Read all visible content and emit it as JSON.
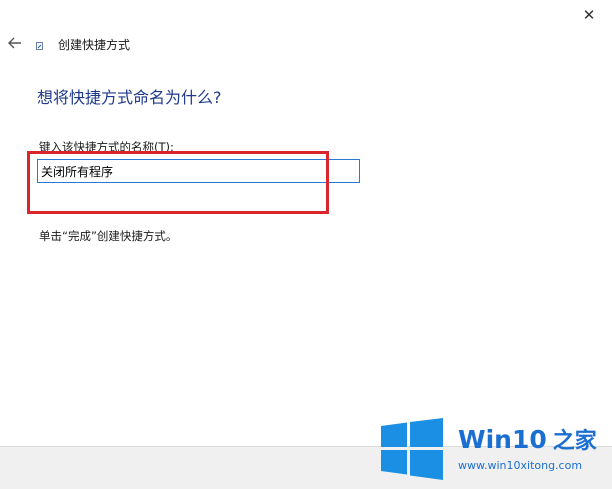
{
  "window": {
    "close_glyph": "✕",
    "back_icon": "arrow-left-icon",
    "title_icon": "shortcut-icon",
    "title": "创建快捷方式"
  },
  "main": {
    "heading": "想将快捷方式命名为什么?",
    "field_label": "键入该快捷方式的名称(T):",
    "field_value": "关闭所有程序",
    "hint": "单击“完成”创建快捷方式。"
  },
  "watermark": {
    "brand": "Win10",
    "brand_cn": "之家",
    "url": "www.win10xitong.com",
    "logo_icon": "windows-logo-icon"
  },
  "colors": {
    "heading": "#1f3a8a",
    "input_border": "#2b78d4",
    "highlight": "#d9262d",
    "brand": "#1a6fd1"
  }
}
